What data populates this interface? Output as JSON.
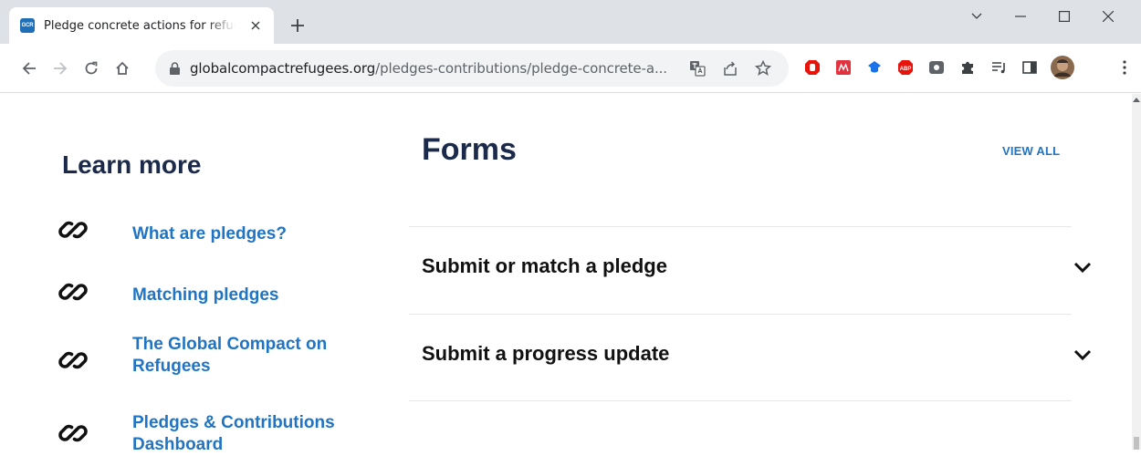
{
  "browser": {
    "tab_title": "Pledge concrete actions for refugees",
    "favicon_text": "GCR",
    "url_domain": "globalcompactrefugees.org",
    "url_path": "/pledges-contributions/pledge-concrete-a..."
  },
  "sidebar": {
    "heading": "Learn more",
    "items": [
      {
        "label": "What are pledges?"
      },
      {
        "label": "Matching pledges"
      },
      {
        "label": "The Global Compact on Refugees"
      },
      {
        "label": "Pledges & Contributions Dashboard"
      }
    ]
  },
  "forms": {
    "heading": "Forms",
    "view_all": "VIEW ALL",
    "items": [
      {
        "label": "Submit or match a pledge"
      },
      {
        "label": "Submit a progress update"
      }
    ]
  },
  "colors": {
    "heading": "#1b2a4a",
    "link": "#1f74c4",
    "tabstrip": "#dee1e6"
  }
}
